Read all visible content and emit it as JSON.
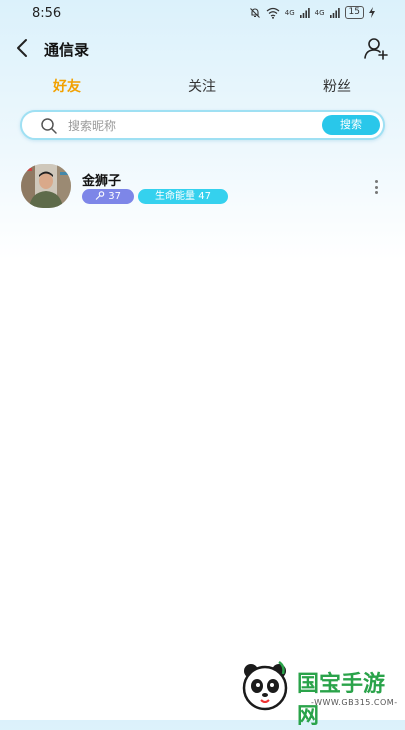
{
  "status_bar": {
    "time": "8:56",
    "signal_1": "4G",
    "signal_2": "4G",
    "battery": "15"
  },
  "header": {
    "title": "通信录"
  },
  "tabs": [
    {
      "label": "好友",
      "active": true
    },
    {
      "label": "关注",
      "active": false
    },
    {
      "label": "粉丝",
      "active": false
    }
  ],
  "search": {
    "placeholder": "搜索昵称",
    "value": "",
    "button_label": "搜索"
  },
  "friends": [
    {
      "name": "金狮子",
      "level_badge": "37",
      "energy_badge": "生命能量 47"
    }
  ],
  "watermark": {
    "brand": "国宝手游网",
    "url": "-WWW.GB315.COM-"
  },
  "colors": {
    "accent_tab": "#f2a100",
    "search_button": "#29c7ea",
    "level_badge": "#7d86e8",
    "energy_badge": "#35d1ee"
  }
}
